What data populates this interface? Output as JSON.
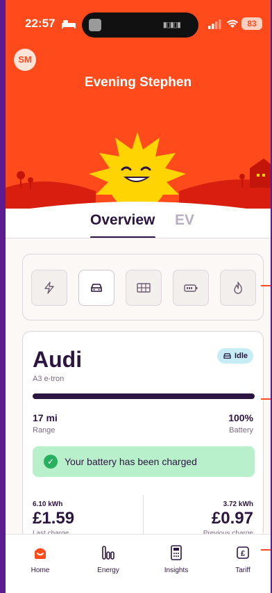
{
  "status_bar": {
    "time": "22:57",
    "battery": "83"
  },
  "user": {
    "initials": "SM"
  },
  "greeting": "Evening Stephen",
  "tabs": {
    "overview": "Overview",
    "ev": "EV"
  },
  "device_selector": {
    "items": [
      "lightning-icon",
      "car-icon",
      "solar-panel-icon",
      "battery-icon",
      "flame-icon"
    ],
    "active": "car-icon"
  },
  "car": {
    "name": "Audi",
    "model": "A3 e-tron",
    "status": "Idle",
    "battery_fraction": 1.0,
    "range_value": "17 mi",
    "range_label": "Range",
    "battery_value": "100%",
    "battery_label": "Battery",
    "charged_message": "Your battery has been charged",
    "last_charge": {
      "kwh": "6.10 kWh",
      "cost": "£1.59",
      "label": "Last charge"
    },
    "previous_charge": {
      "kwh": "3.72 kWh",
      "cost": "£0.97",
      "label": "Previous charge"
    }
  },
  "nav": {
    "home": "Home",
    "energy": "Energy",
    "insights": "Insights",
    "tariff": "Tariff"
  },
  "colors": {
    "accent": "#ff4a1c",
    "primary": "#2c1540",
    "success": "#27b060"
  }
}
